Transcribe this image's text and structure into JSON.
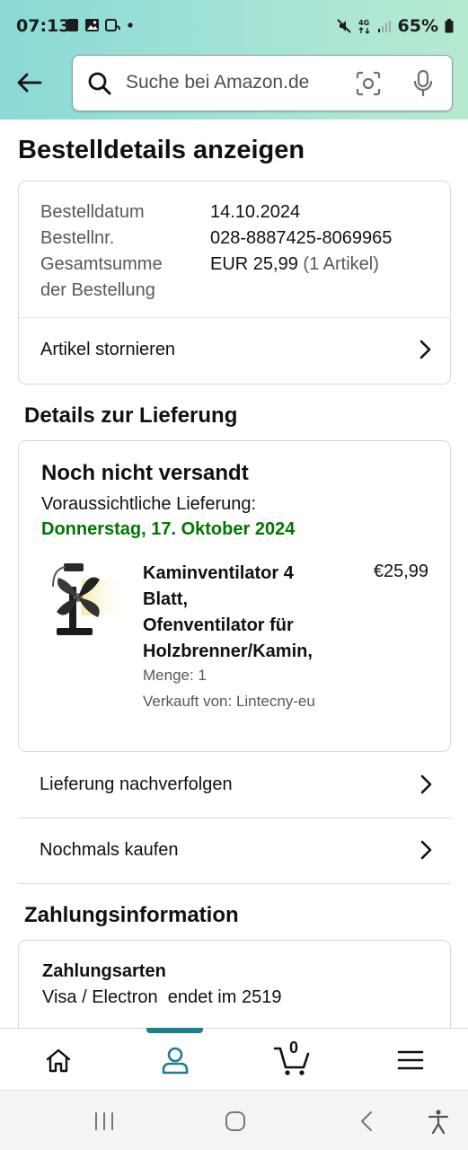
{
  "status_bar": {
    "time": "07:13",
    "battery": "65%",
    "network": "4G"
  },
  "header": {
    "search_placeholder": "Suche bei Amazon.de"
  },
  "page": {
    "title": "Bestelldetails anzeigen"
  },
  "order_summary": {
    "date_label": "Bestelldatum",
    "date_value": "14.10.2024",
    "number_label": "Bestellnr.",
    "number_value": "028-8887425-8069965",
    "total_label_line1": "Gesamtsumme",
    "total_label_line2": "der Bestellung",
    "total_value": "EUR 25,99",
    "total_count": "(1 Artikel)",
    "cancel_label": "Artikel stornieren"
  },
  "delivery": {
    "section_title": "Details zur Lieferung",
    "status": "Noch nicht versandt",
    "eta_label": "Voraussichtliche Lieferung:",
    "eta_date": "Donnerstag, 17. Oktober 2024",
    "product": {
      "title_line1": "Kaminventilator 4",
      "title_line2": "Blatt,",
      "title_line3": "Ofenventilator für",
      "title_line4": "Holzbrenner/Kamin,",
      "price": "€25,99",
      "quantity": "Menge: 1",
      "seller": "Verkauft von: Lintecny-eu"
    },
    "track_label": "Lieferung nachverfolgen",
    "buy_again_label": "Nochmals kaufen"
  },
  "payment": {
    "section_title": "Zahlungsinformation",
    "method_title": "Zahlungsarten",
    "method_value": "Visa / Electron  endet im 2519"
  },
  "tabbar": {
    "cart_count": "0"
  },
  "colors": {
    "accent_teal": "#1b7f8c",
    "delivery_green": "#007600",
    "header_gradient_start": "#8ad9d6",
    "header_gradient_end": "#b6eacf"
  }
}
